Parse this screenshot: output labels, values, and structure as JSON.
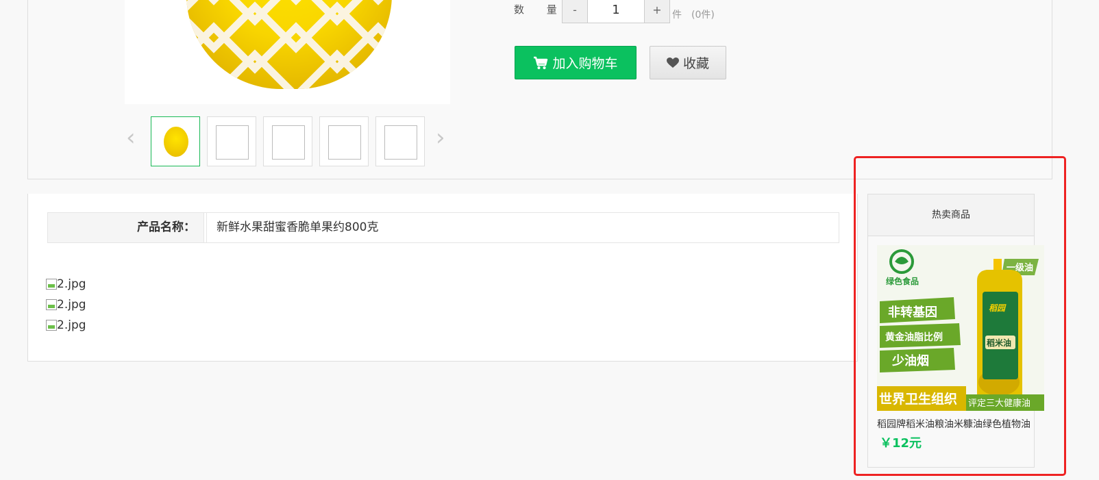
{
  "purchase": {
    "quantity_label": "数 量",
    "minus": "-",
    "quantity_value": "1",
    "plus": "+",
    "unit": "件",
    "stock": "(0件)",
    "add_to_cart": "加入购物车",
    "favorite": "收藏"
  },
  "gallery": {
    "prev_arrow": "‹",
    "next_arrow": "›",
    "thumbnails": [
      "pear",
      "broken",
      "broken",
      "broken",
      "broken"
    ]
  },
  "specs": {
    "name_label": "产品名称：",
    "name_value": "新鲜水果甜蜜香脆单果约800克"
  },
  "detail_images": [
    "2.jpg",
    "2.jpg",
    "2.jpg"
  ],
  "hot": {
    "header": "热卖商品",
    "product": {
      "badge_green": "绿色食品",
      "badge_grade": "一级油",
      "claim_1": "非转基因",
      "claim_2": "黄金油脂比例",
      "claim_3": "少油烟",
      "banner_left": "世界卫生组织",
      "banner_right": "评定三大健康油",
      "bottle_brand": "稻园",
      "bottle_label": "稻米油",
      "name": "稻园牌稻米油粮油米糠油绿色植物油",
      "price": "￥12元"
    }
  },
  "colors": {
    "accent_green": "#0bc15f",
    "highlight_red": "#ee2222"
  }
}
